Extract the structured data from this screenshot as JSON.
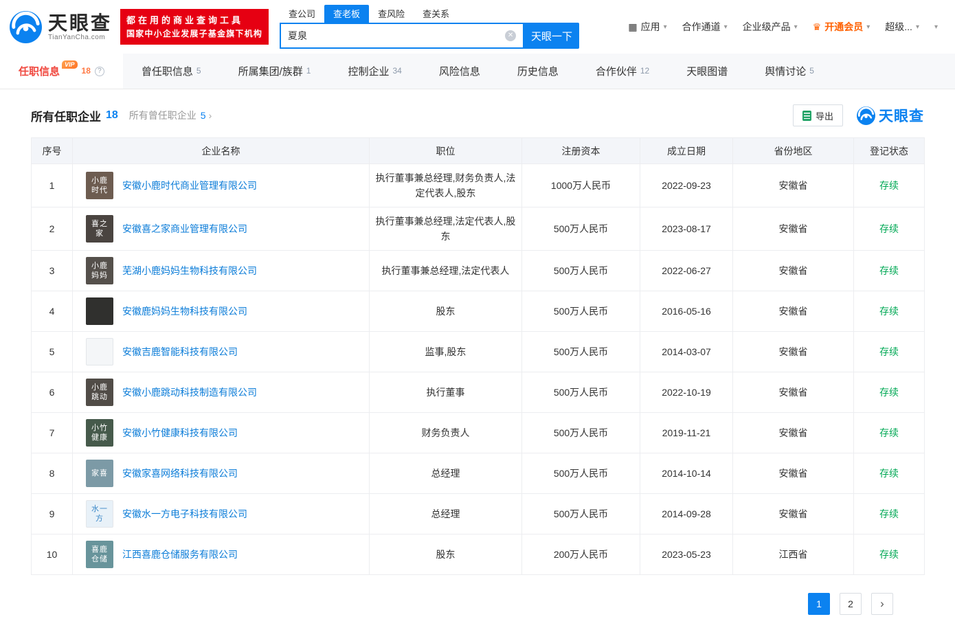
{
  "brand": {
    "logo_title": "天眼查",
    "logo_subtitle": "TianYanCha.com",
    "slogan_line1": "都在用的商业查询工具",
    "slogan_line2": "国家中小企业发展子基金旗下机构"
  },
  "icons": {
    "grid": "▦",
    "crown": "♛",
    "caret": "▾",
    "clear": "✕",
    "help": "?",
    "chevron_right": "›"
  },
  "colors": {
    "accent_blue": "#0b82f0",
    "brand_red": "#e60012",
    "active_tab_red": "#f0483f",
    "count_orange": "#ff7a45",
    "link_blue": "#0b7cd8",
    "status_green": "#00a854"
  },
  "search": {
    "tabs": [
      {
        "name": "company",
        "label": "查公司",
        "active": false
      },
      {
        "name": "boss",
        "label": "查老板",
        "active": true
      },
      {
        "name": "risk",
        "label": "查风险",
        "active": false
      },
      {
        "name": "relation",
        "label": "查关系",
        "active": false
      }
    ],
    "input_value": "夏泉",
    "button_label": "天眼一下"
  },
  "top_nav": [
    {
      "name": "apps",
      "label": "应用",
      "icon": "grid"
    },
    {
      "name": "cooperation",
      "label": "合作通道"
    },
    {
      "name": "enterprise-products",
      "label": "企业级产品"
    },
    {
      "name": "membership",
      "label": "开通会员",
      "icon": "crown",
      "highlight": true
    },
    {
      "name": "super",
      "label": "超级..."
    },
    {
      "name": "more",
      "label": ""
    }
  ],
  "section_tabs": [
    {
      "name": "positions",
      "label": "任职信息",
      "count": "18",
      "active": true,
      "vip": true,
      "help": true
    },
    {
      "name": "former-positions",
      "label": "曾任职信息",
      "count": "5"
    },
    {
      "name": "group",
      "label": "所属集团/族群",
      "count": "1"
    },
    {
      "name": "controlled-companies",
      "label": "控制企业",
      "count": "34"
    },
    {
      "name": "risk-info",
      "label": "风险信息"
    },
    {
      "name": "history-info",
      "label": "历史信息"
    },
    {
      "name": "partners",
      "label": "合作伙伴",
      "count": "12"
    },
    {
      "name": "graph",
      "label": "天眼图谱"
    },
    {
      "name": "opinions",
      "label": "舆情讨论",
      "count": "5"
    }
  ],
  "content_header": {
    "title": "所有任职企业",
    "title_count": "18",
    "sub_link": "所有曾任职企业",
    "sub_count": "5",
    "export_label": "导出",
    "watermark": "天眼查"
  },
  "table": {
    "columns": [
      "序号",
      "企业名称",
      "职位",
      "注册资本",
      "成立日期",
      "省份地区",
      "登记状态"
    ],
    "rows": [
      {
        "index": "1",
        "logo_text": "小鹿时代",
        "logo_bg": "#6d5c50",
        "company": "安徽小鹿时代商业管理有限公司",
        "position": "执行董事兼总经理,财务负责人,法定代表人,股东",
        "capital": "1000万人民币",
        "date": "2022-09-23",
        "region": "安徽省",
        "status": "存续"
      },
      {
        "index": "2",
        "logo_text": "喜之家",
        "logo_bg": "#4a4440",
        "company": "安徽喜之家商业管理有限公司",
        "position": "执行董事兼总经理,法定代表人,股东",
        "capital": "500万人民币",
        "date": "2023-08-17",
        "region": "安徽省",
        "status": "存续"
      },
      {
        "index": "3",
        "logo_text": "小鹿妈妈",
        "logo_bg": "#55504b",
        "company": "芜湖小鹿妈妈生物科技有限公司",
        "position": "执行董事兼总经理,法定代表人",
        "capital": "500万人民币",
        "date": "2022-06-27",
        "region": "安徽省",
        "status": "存续"
      },
      {
        "index": "4",
        "logo_text": "",
        "logo_bg": "#30302e",
        "company": "安徽鹿妈妈生物科技有限公司",
        "position": "股东",
        "capital": "500万人民币",
        "date": "2016-05-16",
        "region": "安徽省",
        "status": "存续"
      },
      {
        "index": "5",
        "logo_text": "",
        "logo_bg": "#f4f6f8",
        "logo_fg": "#9aa7b6",
        "logo_border": true,
        "company": "安徽吉鹿智能科技有限公司",
        "position": "监事,股东",
        "capital": "500万人民币",
        "date": "2014-03-07",
        "region": "安徽省",
        "status": "存续"
      },
      {
        "index": "6",
        "logo_text": "小鹿跳动",
        "logo_bg": "#514c47",
        "company": "安徽小鹿跳动科技制造有限公司",
        "position": "执行董事",
        "capital": "500万人民币",
        "date": "2022-10-19",
        "region": "安徽省",
        "status": "存续"
      },
      {
        "index": "7",
        "logo_text": "小竹健康",
        "logo_bg": "#465a4b",
        "company": "安徽小竹健康科技有限公司",
        "position": "财务负责人",
        "capital": "500万人民币",
        "date": "2019-11-21",
        "region": "安徽省",
        "status": "存续"
      },
      {
        "index": "8",
        "logo_text": "家喜",
        "logo_bg": "#7c9aa6",
        "company": "安徽家喜网络科技有限公司",
        "position": "总经理",
        "capital": "500万人民币",
        "date": "2014-10-14",
        "region": "安徽省",
        "status": "存续"
      },
      {
        "index": "9",
        "logo_text": "水一方",
        "logo_bg": "#e8f1f8",
        "logo_fg": "#3a87c8",
        "logo_border": true,
        "company": "安徽水一方电子科技有限公司",
        "position": "总经理",
        "capital": "500万人民币",
        "date": "2014-09-28",
        "region": "安徽省",
        "status": "存续"
      },
      {
        "index": "10",
        "logo_text": "喜鹿仓储",
        "logo_bg": "#68949b",
        "company": "江西喜鹿仓储服务有限公司",
        "position": "股东",
        "capital": "200万人民币",
        "date": "2023-05-23",
        "region": "江西省",
        "status": "存续"
      }
    ]
  },
  "pagination": {
    "pages": [
      {
        "label": "1",
        "active": true
      },
      {
        "label": "2",
        "active": false
      }
    ],
    "next_icon": "›"
  }
}
